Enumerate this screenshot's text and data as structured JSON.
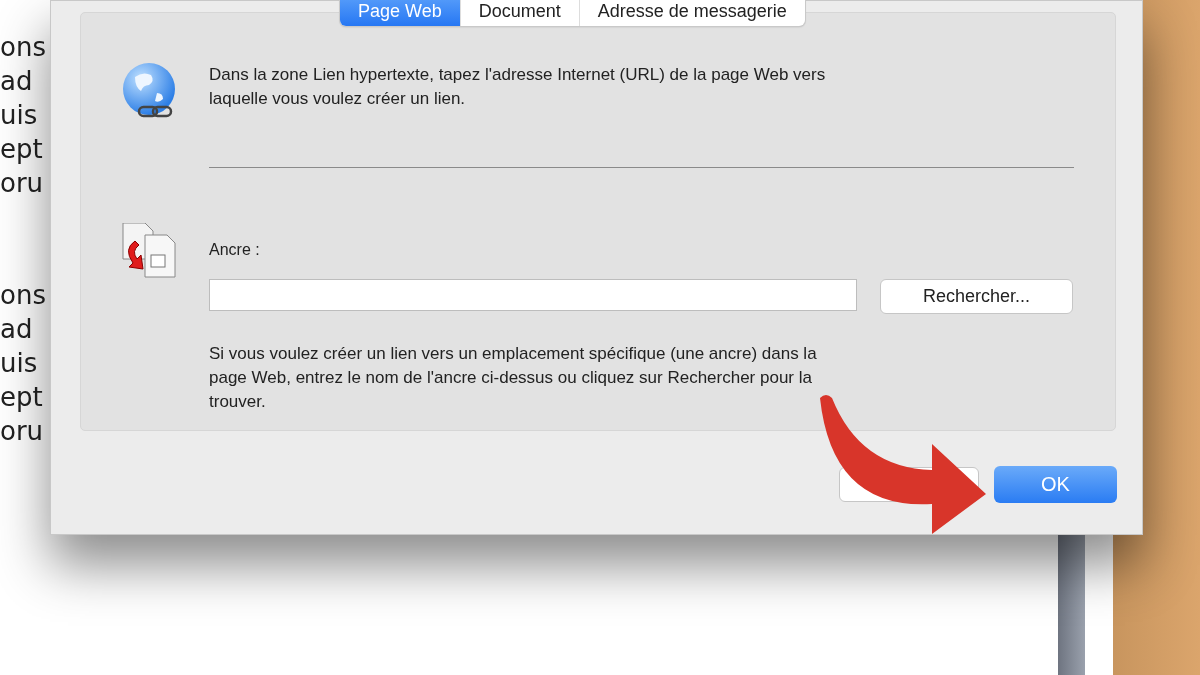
{
  "document": {
    "lines_top": [
      "ons",
      "ad",
      "uis",
      "ept",
      "oru"
    ],
    "lines_bottom": [
      "ons",
      "ad",
      "uis",
      "ept",
      "oru"
    ]
  },
  "dialog": {
    "tabs": [
      {
        "label": "Page Web",
        "selected": true
      },
      {
        "label": "Document",
        "selected": false
      },
      {
        "label": "Adresse de messagerie",
        "selected": false
      }
    ],
    "intro": "Dans la zone Lien hypertexte, tapez l'adresse Internet (URL) de la page Web vers laquelle vous voulez créer un lien.",
    "anchor_label": "Ancre :",
    "browse_button": "Rechercher...",
    "help": "Si vous voulez créer un lien vers un emplacement spécifique (une ancre) dans la page Web, entrez le nom de l'ancre ci-dessus ou cliquez sur Rechercher pour la trouver.",
    "ok_button": "OK"
  }
}
